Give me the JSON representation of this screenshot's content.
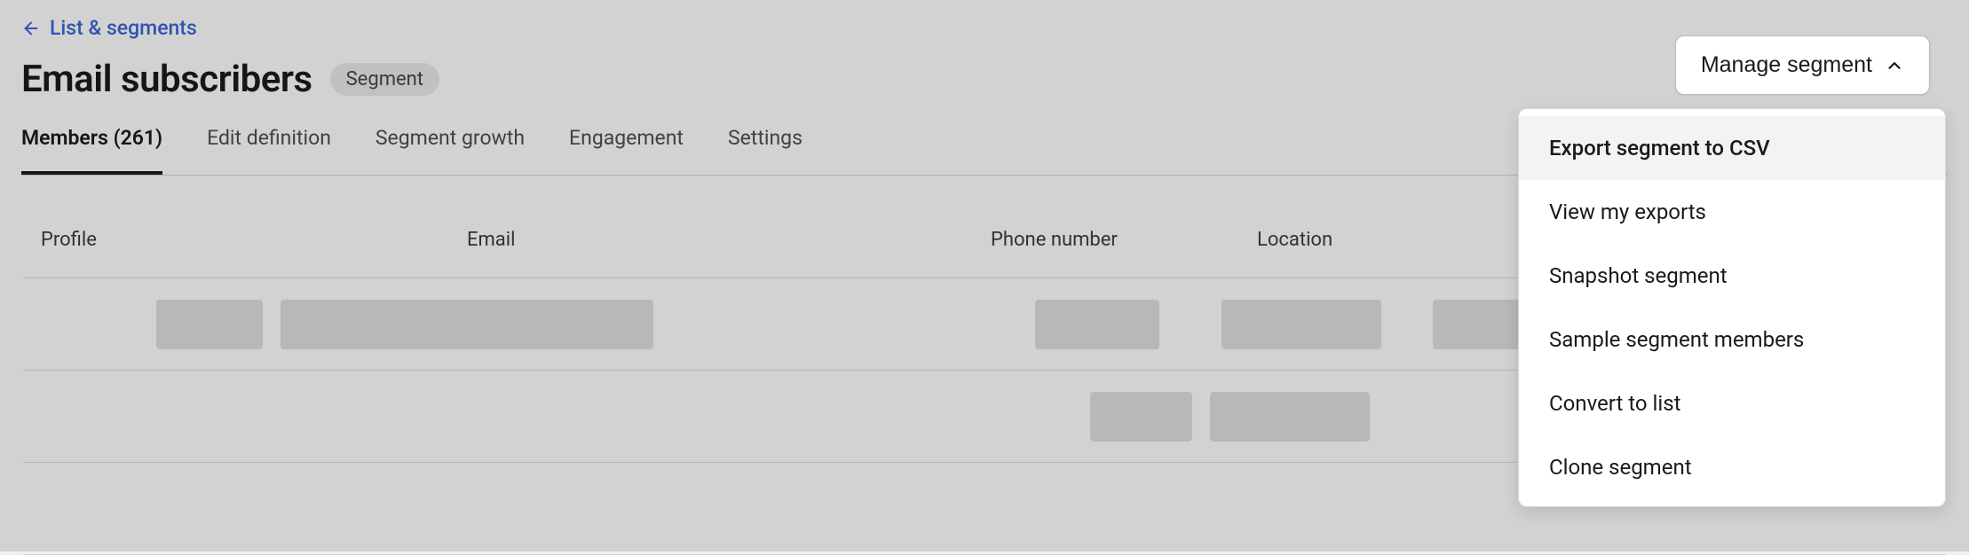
{
  "breadcrumb": {
    "label": "List & segments"
  },
  "header": {
    "title": "Email subscribers",
    "badge": "Segment"
  },
  "manage_button": {
    "label": "Manage segment"
  },
  "tabs": [
    {
      "label": "Members (261)",
      "active": true
    },
    {
      "label": "Edit definition",
      "active": false
    },
    {
      "label": "Segment growth",
      "active": false
    },
    {
      "label": "Engagement",
      "active": false
    },
    {
      "label": "Settings",
      "active": false
    }
  ],
  "table": {
    "columns": {
      "profile": "Profile",
      "email": "Email",
      "phone": "Phone number",
      "location": "Location"
    }
  },
  "dropdown": {
    "items": [
      {
        "label": "Export segment to CSV",
        "highlight": true
      },
      {
        "label": "View my exports",
        "highlight": false
      },
      {
        "label": "Snapshot segment",
        "highlight": false
      },
      {
        "label": "Sample segment members",
        "highlight": false
      },
      {
        "label": "Convert to list",
        "highlight": false
      },
      {
        "label": "Clone segment",
        "highlight": false
      }
    ]
  }
}
